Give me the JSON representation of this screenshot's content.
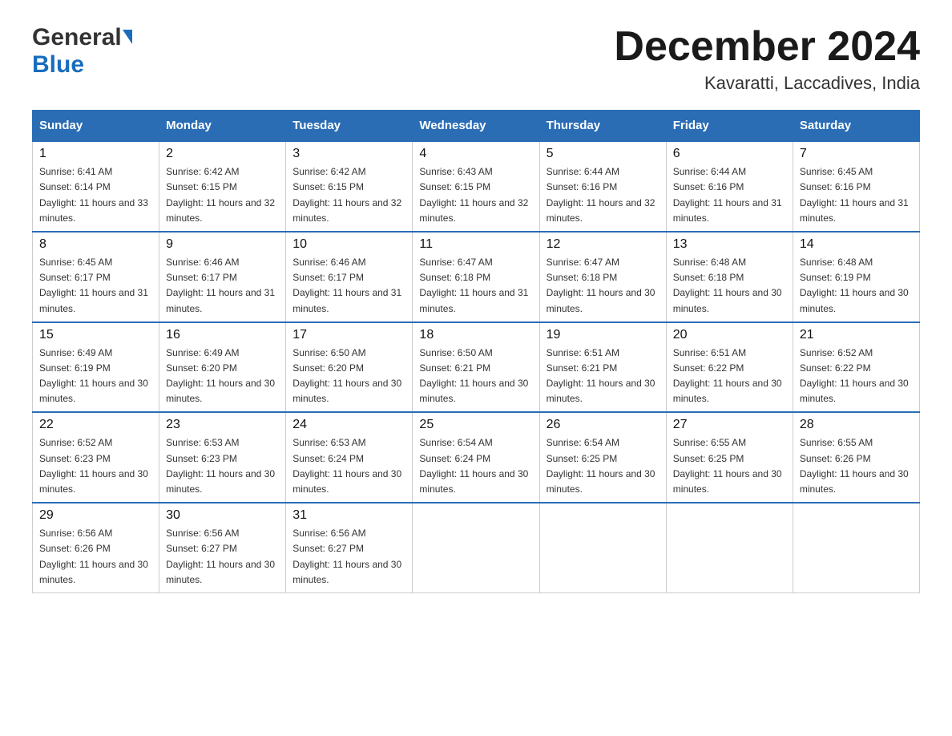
{
  "logo": {
    "line1": "General",
    "line2": "Blue"
  },
  "title": "December 2024",
  "subtitle": "Kavaratti, Laccadives, India",
  "days": [
    "Sunday",
    "Monday",
    "Tuesday",
    "Wednesday",
    "Thursday",
    "Friday",
    "Saturday"
  ],
  "weeks": [
    [
      {
        "day": "1",
        "sunrise": "6:41 AM",
        "sunset": "6:14 PM",
        "daylight": "11 hours and 33 minutes."
      },
      {
        "day": "2",
        "sunrise": "6:42 AM",
        "sunset": "6:15 PM",
        "daylight": "11 hours and 32 minutes."
      },
      {
        "day": "3",
        "sunrise": "6:42 AM",
        "sunset": "6:15 PM",
        "daylight": "11 hours and 32 minutes."
      },
      {
        "day": "4",
        "sunrise": "6:43 AM",
        "sunset": "6:15 PM",
        "daylight": "11 hours and 32 minutes."
      },
      {
        "day": "5",
        "sunrise": "6:44 AM",
        "sunset": "6:16 PM",
        "daylight": "11 hours and 32 minutes."
      },
      {
        "day": "6",
        "sunrise": "6:44 AM",
        "sunset": "6:16 PM",
        "daylight": "11 hours and 31 minutes."
      },
      {
        "day": "7",
        "sunrise": "6:45 AM",
        "sunset": "6:16 PM",
        "daylight": "11 hours and 31 minutes."
      }
    ],
    [
      {
        "day": "8",
        "sunrise": "6:45 AM",
        "sunset": "6:17 PM",
        "daylight": "11 hours and 31 minutes."
      },
      {
        "day": "9",
        "sunrise": "6:46 AM",
        "sunset": "6:17 PM",
        "daylight": "11 hours and 31 minutes."
      },
      {
        "day": "10",
        "sunrise": "6:46 AM",
        "sunset": "6:17 PM",
        "daylight": "11 hours and 31 minutes."
      },
      {
        "day": "11",
        "sunrise": "6:47 AM",
        "sunset": "6:18 PM",
        "daylight": "11 hours and 31 minutes."
      },
      {
        "day": "12",
        "sunrise": "6:47 AM",
        "sunset": "6:18 PM",
        "daylight": "11 hours and 30 minutes."
      },
      {
        "day": "13",
        "sunrise": "6:48 AM",
        "sunset": "6:18 PM",
        "daylight": "11 hours and 30 minutes."
      },
      {
        "day": "14",
        "sunrise": "6:48 AM",
        "sunset": "6:19 PM",
        "daylight": "11 hours and 30 minutes."
      }
    ],
    [
      {
        "day": "15",
        "sunrise": "6:49 AM",
        "sunset": "6:19 PM",
        "daylight": "11 hours and 30 minutes."
      },
      {
        "day": "16",
        "sunrise": "6:49 AM",
        "sunset": "6:20 PM",
        "daylight": "11 hours and 30 minutes."
      },
      {
        "day": "17",
        "sunrise": "6:50 AM",
        "sunset": "6:20 PM",
        "daylight": "11 hours and 30 minutes."
      },
      {
        "day": "18",
        "sunrise": "6:50 AM",
        "sunset": "6:21 PM",
        "daylight": "11 hours and 30 minutes."
      },
      {
        "day": "19",
        "sunrise": "6:51 AM",
        "sunset": "6:21 PM",
        "daylight": "11 hours and 30 minutes."
      },
      {
        "day": "20",
        "sunrise": "6:51 AM",
        "sunset": "6:22 PM",
        "daylight": "11 hours and 30 minutes."
      },
      {
        "day": "21",
        "sunrise": "6:52 AM",
        "sunset": "6:22 PM",
        "daylight": "11 hours and 30 minutes."
      }
    ],
    [
      {
        "day": "22",
        "sunrise": "6:52 AM",
        "sunset": "6:23 PM",
        "daylight": "11 hours and 30 minutes."
      },
      {
        "day": "23",
        "sunrise": "6:53 AM",
        "sunset": "6:23 PM",
        "daylight": "11 hours and 30 minutes."
      },
      {
        "day": "24",
        "sunrise": "6:53 AM",
        "sunset": "6:24 PM",
        "daylight": "11 hours and 30 minutes."
      },
      {
        "day": "25",
        "sunrise": "6:54 AM",
        "sunset": "6:24 PM",
        "daylight": "11 hours and 30 minutes."
      },
      {
        "day": "26",
        "sunrise": "6:54 AM",
        "sunset": "6:25 PM",
        "daylight": "11 hours and 30 minutes."
      },
      {
        "day": "27",
        "sunrise": "6:55 AM",
        "sunset": "6:25 PM",
        "daylight": "11 hours and 30 minutes."
      },
      {
        "day": "28",
        "sunrise": "6:55 AM",
        "sunset": "6:26 PM",
        "daylight": "11 hours and 30 minutes."
      }
    ],
    [
      {
        "day": "29",
        "sunrise": "6:56 AM",
        "sunset": "6:26 PM",
        "daylight": "11 hours and 30 minutes."
      },
      {
        "day": "30",
        "sunrise": "6:56 AM",
        "sunset": "6:27 PM",
        "daylight": "11 hours and 30 minutes."
      },
      {
        "day": "31",
        "sunrise": "6:56 AM",
        "sunset": "6:27 PM",
        "daylight": "11 hours and 30 minutes."
      },
      null,
      null,
      null,
      null
    ]
  ]
}
